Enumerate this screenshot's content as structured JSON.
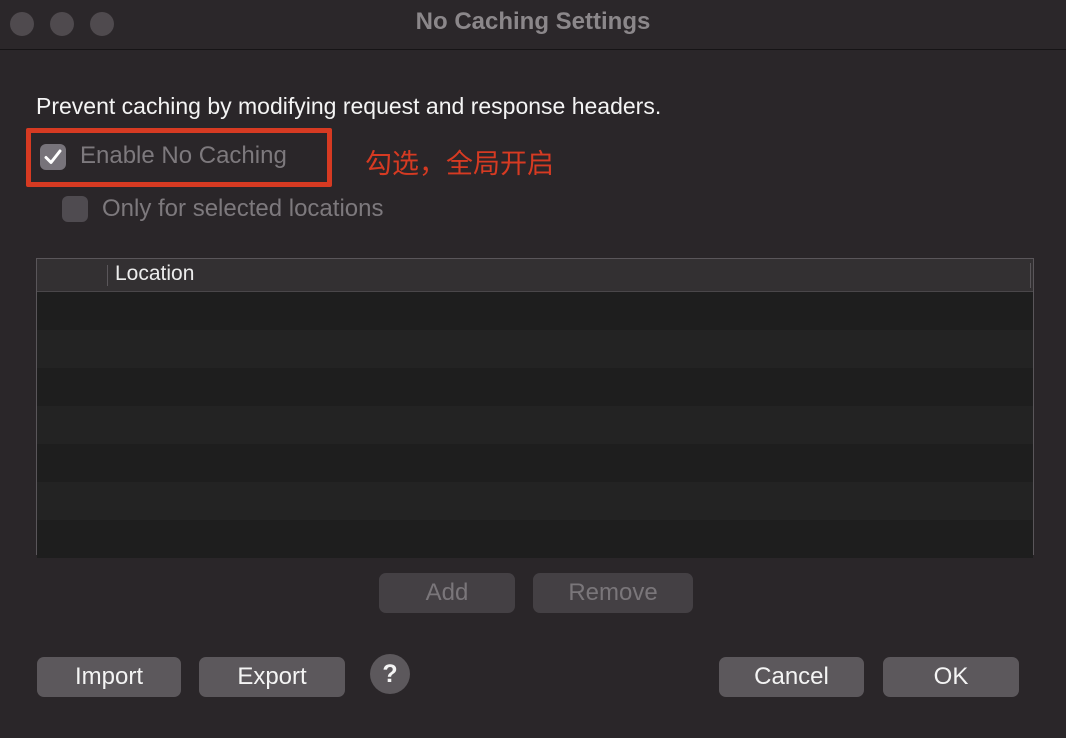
{
  "window": {
    "title": "No Caching Settings"
  },
  "description": "Prevent caching by modifying request and response headers.",
  "options": {
    "enable_label": "Enable No Caching",
    "enable_checked": true,
    "only_selected_label": "Only for selected locations",
    "only_selected_checked": false
  },
  "annotation": {
    "text": "勾选，全局开启",
    "color": "#d63a22"
  },
  "table": {
    "columns": [
      "",
      "Location"
    ],
    "rows": []
  },
  "table_buttons": {
    "add": "Add",
    "remove": "Remove"
  },
  "footer": {
    "import": "Import",
    "export": "Export",
    "help": "?",
    "cancel": "Cancel",
    "ok": "OK"
  },
  "colors": {
    "background": "#2a2629",
    "accent_red": "#d63a22"
  }
}
